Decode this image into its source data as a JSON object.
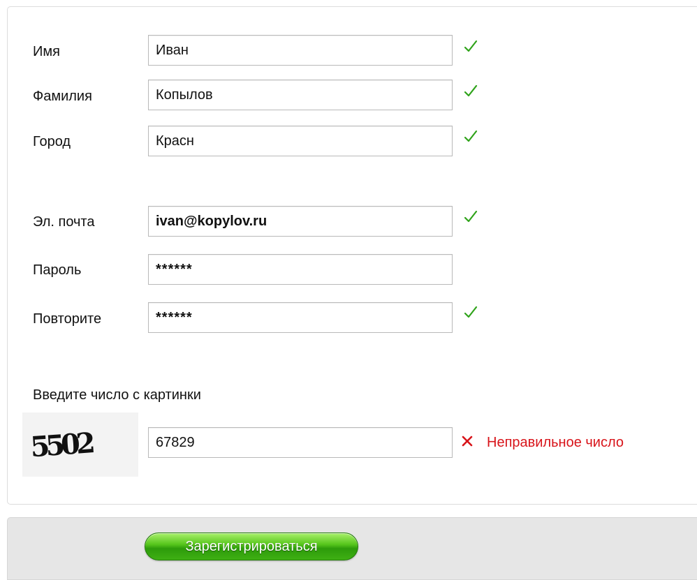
{
  "form": {
    "first_name": {
      "label": "Имя",
      "value": "Иван",
      "status": "valid"
    },
    "last_name": {
      "label": "Фамилия",
      "value": "Копылов",
      "status": "valid"
    },
    "city": {
      "label": "Город",
      "value": "Красн",
      "status": "valid"
    },
    "email": {
      "label": "Эл. почта",
      "value": "ivan@kopylov.ru",
      "status": "valid"
    },
    "password": {
      "label": "Пароль",
      "value": "******"
    },
    "password_repeat": {
      "label": "Повторите",
      "value": "******",
      "status": "valid"
    }
  },
  "captcha": {
    "caption": "Введите число с картинки",
    "image_text": "5502",
    "value": "67829",
    "error": "Неправильное число"
  },
  "footer": {
    "submit_label": "Зарегистрироваться"
  },
  "colors": {
    "valid": "#2fa31a",
    "error": "#d8141a",
    "button": "#3fb014"
  },
  "icons": {
    "valid": "check-icon",
    "error": "close-icon"
  }
}
